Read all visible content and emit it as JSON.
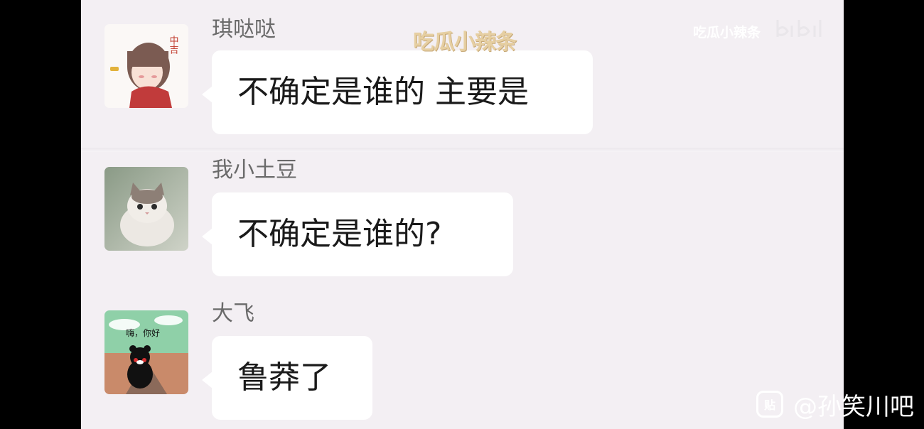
{
  "messages": [
    {
      "sender": "琪哒哒",
      "text": "不确定是谁的 主要是",
      "avatar_icon": "anime-girl-avatar",
      "avatar_text": "中吉"
    },
    {
      "sender": "我小土豆",
      "text": "不确定是谁的?",
      "avatar_icon": "cat-avatar"
    },
    {
      "sender": "大飞",
      "text": "鲁莽了",
      "avatar_icon": "kumamon-avatar",
      "avatar_text": "嗨，你好"
    }
  ],
  "watermarks": {
    "center": "吃瓜小辣条",
    "top_right": "吃瓜小辣条",
    "platform_logo": "bilibili",
    "bottom_right": "@孙笑川吧",
    "tieba_icon": "tieba-icon"
  },
  "colors": {
    "chat_background": "#f3eff3",
    "bubble": "#ffffff",
    "sender_text": "#6a6a6a",
    "message_text": "#1a1a1a"
  }
}
